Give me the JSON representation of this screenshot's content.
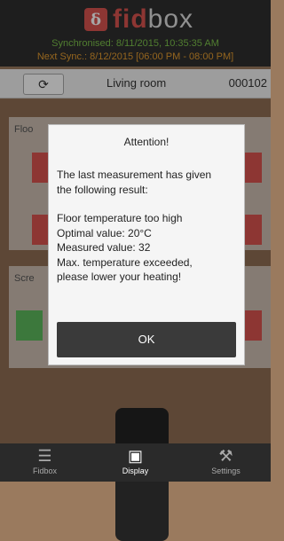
{
  "header": {
    "logo_letter": "δ",
    "logo_text_main": "fid",
    "logo_text_box": "box",
    "sync_line": "Synchronised: 8/11/2015, 10:35:35 AM",
    "next_sync_line": "Next Sync.: 8/12/2015 [06:00 PM - 08:00 PM]",
    "colors": {
      "brand": "#d9534f",
      "sync": "#7cc14a",
      "next_sync": "#e39b2f"
    }
  },
  "room_bar": {
    "refresh_icon": "refresh-icon",
    "room_name": "Living room",
    "room_id": "000102"
  },
  "background": {
    "card1_title": "Floo",
    "card2_title": "Scre"
  },
  "dialog": {
    "title": "Attention!",
    "body_lines": [
      "The last measurement has given",
      "the following result:",
      "",
      "Floor temperature too high",
      "Optimal value: 20°C",
      "Measured value: 32",
      "Max. temperature exceeded,",
      "please lower your heating!"
    ],
    "ok_label": "OK"
  },
  "tabbar": {
    "tabs": [
      {
        "label": "Fidbox",
        "icon": "layers-icon",
        "active": false
      },
      {
        "label": "Display",
        "icon": "display-icon",
        "active": true
      },
      {
        "label": "Settings",
        "icon": "tools-icon",
        "active": false
      }
    ]
  }
}
